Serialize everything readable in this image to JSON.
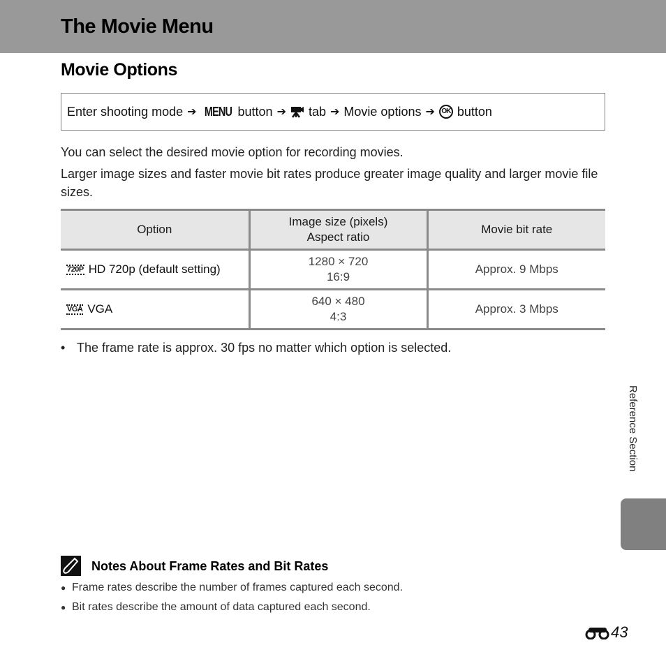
{
  "header": {
    "title": "The Movie Menu"
  },
  "section": {
    "title": "Movie Options"
  },
  "nav_path": {
    "steps": [
      "Enter shooting mode",
      "MENU",
      "button",
      "tab",
      "Movie options",
      "OK",
      "button"
    ],
    "step1": "Enter shooting mode",
    "menu_glyph": "MENU",
    "button_word1": "button",
    "tab_word": "tab",
    "movie_options": "Movie options",
    "ok_glyph": "OK",
    "button_word2": "button",
    "arrow": "➔",
    "movie_tab_icon": "movie-camera-icon"
  },
  "body": {
    "para1": "You can select the desired movie option for recording movies.",
    "para2": "Larger image sizes and faster movie bit rates produce greater image quality and larger movie file sizes."
  },
  "table": {
    "headers": {
      "option": "Option",
      "image_size_line1": "Image size (pixels)",
      "image_size_line2": "Aspect ratio",
      "bitrate": "Movie bit rate"
    },
    "rows": [
      {
        "icon": "720P",
        "option": "HD 720p (default setting)",
        "size": "1280 × 720",
        "ratio": "16:9",
        "bitrate": "Approx. 9 Mbps"
      },
      {
        "icon": "VGA",
        "option": "VGA",
        "size": "640 × 480",
        "ratio": "4:3",
        "bitrate": "Approx. 3 Mbps"
      }
    ]
  },
  "bullet": "The frame rate is approx. 30 fps no matter which option is selected.",
  "notes": {
    "title": "Notes About Frame Rates and Bit Rates",
    "items": [
      "Frame rates describe the number of frames captured each second.",
      "Bit rates describe the amount of data captured each second."
    ]
  },
  "side": {
    "label": "Reference Section",
    "tab_color": "#808080"
  },
  "footer": {
    "page_prefix_icon": "binoculars-icon",
    "page_number": "43"
  },
  "colors": {
    "header_band": "#999999",
    "table_header_bg": "#e6e6e6",
    "table_border": "#8a8a8a"
  }
}
